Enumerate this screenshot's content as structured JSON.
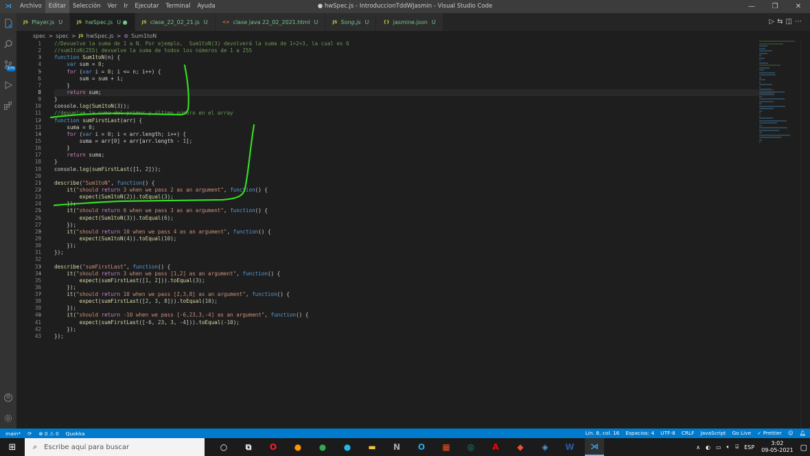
{
  "window": {
    "title": "● hwSpec.js - IntroduccionTddWJasmin - Visual Studio Code",
    "menu": [
      "Archivo",
      "Editar",
      "Selección",
      "Ver",
      "Ir",
      "Ejecutar",
      "Terminal",
      "Ayuda"
    ],
    "active_menu": "Editar"
  },
  "activity_badge": "370",
  "tabs": [
    {
      "icon": "JS",
      "name": "Player.js",
      "status": "U",
      "active": false,
      "italic": false
    },
    {
      "icon": "JS",
      "name": "hwSpec.js",
      "status": "U ●",
      "active": true,
      "italic": false
    },
    {
      "icon": "JS",
      "name": "clase_22_02_21.js",
      "status": "U",
      "active": false,
      "italic": false
    },
    {
      "icon": "<>",
      "name": "clase java 22_02_2021.html",
      "status": "U",
      "active": false,
      "italic": false
    },
    {
      "icon": "JS",
      "name": "Song.js",
      "status": "U",
      "active": false,
      "italic": true
    },
    {
      "icon": "{}",
      "name": "jasmine.json",
      "status": "U",
      "active": false,
      "italic": false
    }
  ],
  "breadcrumb": [
    "spec",
    ">",
    "spec",
    ">",
    "JS",
    "hwSpec.js",
    ">",
    "Sum1toN"
  ],
  "code_lines": [
    "//Devuelve la suma de 1 a N. Por ejemplo,  Sum1toN(3) devolverá la suma de 1+2+3, la cual es 6",
    "//sum1toN(255) devuelve la suma de todos los números de 1 a 255",
    "function Sum1toN(n) {",
    "    var sum = 0;",
    "    for (var i = 0; i <= n; i++) {",
    "        sum = sum + i;",
    "    }",
    "    return sum;",
    "}",
    "console.log(Sum1toN(3));",
    "//devuelve la suma del primer y último número en el array",
    "function sumFirstLast(arr) {",
    "    suma = 0;",
    "    for (var i = 0; i < arr.length; i++) {",
    "        suma = arr[0] + arr[arr.length - 1];",
    "    }",
    "    return suma;",
    "}",
    "console.log(sumFirstLast([1, 2]));",
    "",
    "describe(\"Sum1toN\", function() {",
    "    it(\"should return 3 when we pass 2 as an argument\", function() {",
    "        expect(Sum1toN(2)).toEqual(3);",
    "    });",
    "    it(\"should return 6 when we pass 3 as an argument\", function() {",
    "        expect(Sum1toN(3)).toEqual(6);",
    "    });",
    "    it(\"should return 10 when we pass 4 as an argument\", function() {",
    "        expect(Sum1toN(4)).toEqual(10);",
    "    });",
    "});",
    "",
    "describe(\"sumFirstLast\", function() {",
    "    it(\"should return 3 when we pass [1,2] as an argument\", function() {",
    "        expect(sumFirstLast([1, 2])).toEqual(3);",
    "    });",
    "    it(\"should return 10 when we pass [2,3,8] as an argument\", function() {",
    "        expect(sumFirstLast([2, 3, 8])).toEqual(10);",
    "    });",
    "    it(\"should return -10 when we pass [-6,23,3,-4] as an argument\", function() {",
    "        expect(sumFirstLast([-6, 23, 3, -4])).toEqual(-10);",
    "    });",
    "});"
  ],
  "current_line": 8,
  "status_bar": {
    "branch": "main*",
    "sync": "⟳",
    "problems": "⊗ 0 ⚠ 0",
    "quokka": "Quokka",
    "position": "Lín. 8, col. 16",
    "spaces": "Espacios: 4",
    "encoding": "UTF-8",
    "eol": "CRLF",
    "language": "JavaScript",
    "golive": "Go Live",
    "prettier": "✓ Prettier"
  },
  "taskbar": {
    "search_placeholder": "Escribe aquí para buscar",
    "lang": "ESP",
    "time": "3:02",
    "date": "09-05-2021"
  },
  "colors": {
    "accent": "#007acc",
    "annotation": "#33dd22"
  }
}
